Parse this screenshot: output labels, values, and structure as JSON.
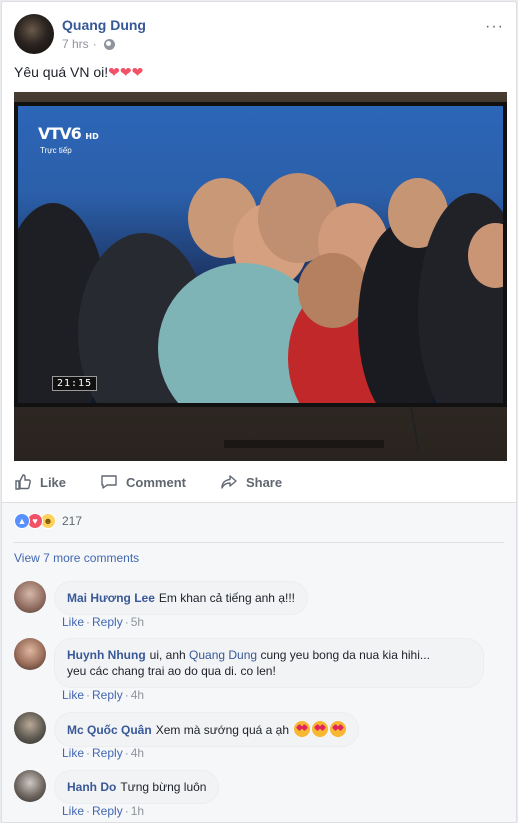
{
  "post": {
    "author": "Quang Dung",
    "time": "7 hrs",
    "more_icon": "···",
    "text": "Yêu quá VN oi!",
    "hearts": "❤❤❤"
  },
  "photo": {
    "channel_logo": "VTV6",
    "channel_hd": "HD",
    "live_label": "Trực tiếp",
    "clock": "21:15"
  },
  "actions": {
    "like": "Like",
    "comment": "Comment",
    "share": "Share"
  },
  "reactions": {
    "types": [
      "like",
      "love",
      "haha"
    ],
    "count": "217"
  },
  "view_more": "View 7 more comments",
  "comments": [
    {
      "name": "Mai Hương Lee",
      "text": "Em khan cả tiếng anh ạ!!!",
      "like": "Like",
      "reply": "Reply",
      "time": "5h"
    },
    {
      "name": "Huynh Nhung",
      "text_before": "ui, anh",
      "mention": "Quang Dung",
      "text_after": "cung yeu bong da nua kia hihi...",
      "text_line2": "yeu các chang trai ao do qua di. co len!",
      "like": "Like",
      "reply": "Reply",
      "time": "4h"
    },
    {
      "name": "Mc Quốc Quân",
      "text": "Xem mà sướng quá a ạh",
      "like": "Like",
      "reply": "Reply",
      "time": "4h"
    },
    {
      "name": "Hanh Do",
      "text": "Tưng bừng luôn",
      "like": "Like",
      "reply": "Reply",
      "time": "1h"
    }
  ],
  "colors": {
    "link": "#365899",
    "accent": "#4267b2",
    "meta": "#90949c",
    "heart": "#f25268"
  }
}
